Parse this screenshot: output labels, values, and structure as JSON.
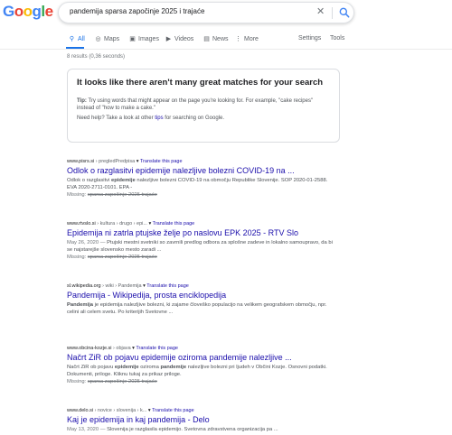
{
  "logo": {
    "letters": [
      "G",
      "o",
      "o",
      "g",
      "l",
      "e"
    ],
    "colors": [
      "#4285f4",
      "#ea4335",
      "#fbbc05",
      "#4285f4",
      "#34a853",
      "#ea4335"
    ]
  },
  "search": {
    "query": "pandemija sparsa započinje 2025 i trajaće",
    "clear_glyph": "✕"
  },
  "tabs": {
    "all": "All",
    "maps": "Maps",
    "images": "Images",
    "videos": "Videos",
    "news": "News",
    "more": "More",
    "settings": "Settings",
    "tools": "Tools"
  },
  "stats": "8 results (0,36 seconds)",
  "notice": {
    "heading": "It looks like there aren't many great matches for your search",
    "tip_label": "Tip:",
    "tip_text": " Try using words that might appear on the page you're looking for. For example, \"cake recipes\" instead of \"how to make a cake.\"",
    "help_prefix": "Need help? Take a look at other ",
    "help_link": "tips",
    "help_suffix": " for searching on Google."
  },
  "translate_label": "Translate this page",
  "missing_label": "Missing: ",
  "missing_terms": "sparsa započinje 2025 trajaće",
  "results": [
    {
      "domain": "www.pisrs.si",
      "breadcrumb": " › pregledPredpisa",
      "title": "Odlok o razglasitvi epidemije nalezljive bolezni COVID-19 na ...",
      "snippet_parts": [
        "Odlok o razglasitvi ",
        "epidemije",
        " nalezljive bolezni COVID-19 na območju Republike Slovenije. SOP 2020-01-2588. EVA 2020-2711-0101. EPA -"
      ],
      "date": ""
    },
    {
      "domain": "www.rtvslo.si",
      "breadcrumb": " › kultura › drugo › epi...",
      "title": "Epidemija ni zatrla ptujske želje po naslovu EPK 2025 - RTV Slo",
      "snippet_parts": [
        "",
        "",
        "Ptujski mestni svetniki so zavrnili predlog odbora za splošne zadeve in lokalno samoupravo, da bi se najstarejše slovensko mesto zaradi ..."
      ],
      "date": "May 26, 2020 — "
    },
    {
      "domain": "sl.wikipedia.org",
      "breadcrumb": " › wiki › Pandemija",
      "title": "Pandemija - Wikipedija, prosta enciklopedija",
      "snippet_parts": [
        "",
        "Pandemija",
        " je epidemija nalezljive bolezni, ki zajame človeško populacijo na velikem geografskem območju, npr. celini ali celem svetu. Po kriterijih Svetovne ..."
      ],
      "date": ""
    },
    {
      "domain": "www.obcina-kozje.si",
      "breadcrumb": " › objava",
      "title": "Načrt ZiR ob pojavu epidemije oziroma pandemije nalezljive ...",
      "snippet_parts": [
        "Načrt ZiR ob pojavu ",
        "epidemije",
        " oziroma ",
        "pandemije",
        " nalezljive bolezni pri ljudeh v Občini Kozje. Osnovni podatki. Dokumenti, priloge. Kliknu tukaj za prikaz priloge."
      ],
      "date": ""
    },
    {
      "domain": "www.delo.si",
      "breadcrumb": " › novice › slovenija › k...",
      "title": "Kaj je epidemija in kaj pandemija - Delo",
      "snippet_parts": [
        "",
        "",
        "Slovenija je razglasila epidemijo. Svetovna zdravstvena organizacija pa ..."
      ],
      "date": "May 13, 2020 — "
    }
  ]
}
